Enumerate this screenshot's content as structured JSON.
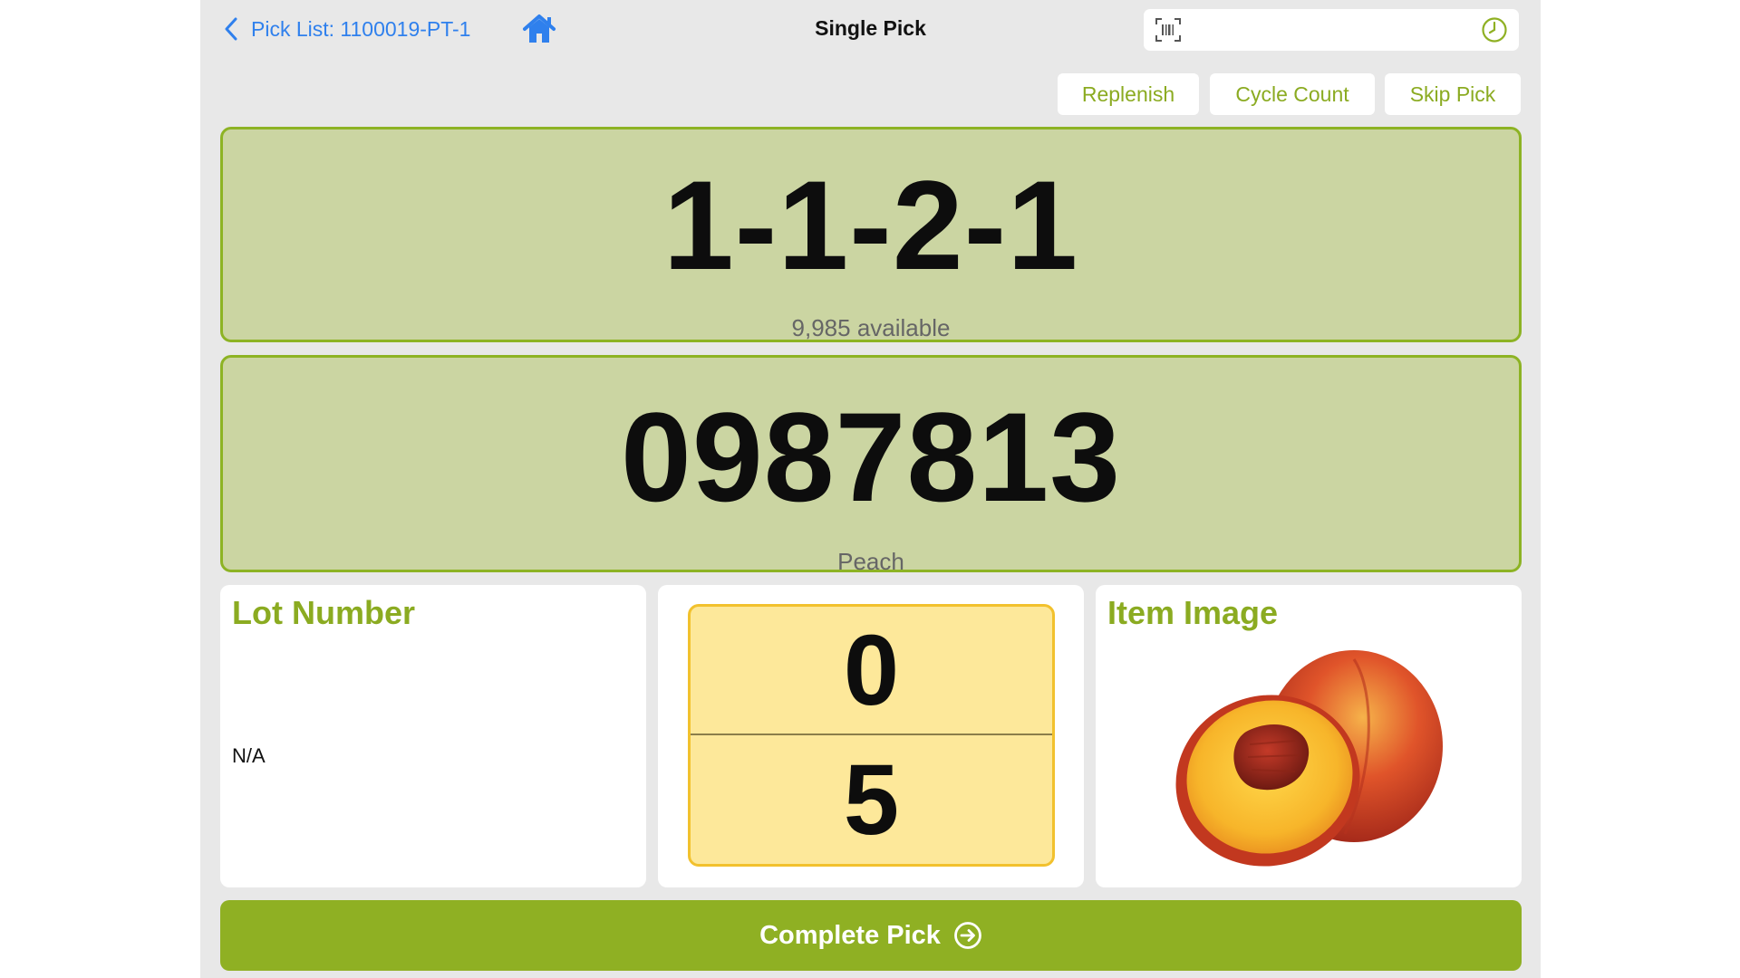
{
  "header": {
    "back_label": "Pick List: 1100019-PT-1",
    "title": "Single Pick",
    "search_placeholder": ""
  },
  "actions": {
    "replenish": "Replenish",
    "cycle_count": "Cycle Count",
    "skip_pick": "Skip Pick"
  },
  "location": {
    "code": "1-1-2-1",
    "available": "9,985 available"
  },
  "item": {
    "code": "0987813",
    "name": "Peach"
  },
  "lot": {
    "heading": "Lot Number",
    "value": "N/A"
  },
  "quantity": {
    "picked": "0",
    "required": "5"
  },
  "image_panel": {
    "heading": "Item Image",
    "image_icon": "peach-image"
  },
  "footer": {
    "complete_label": "Complete Pick"
  },
  "colors": {
    "accent_green": "#8fb023",
    "card_green": "#cbd5a2",
    "link_blue": "#2f80ed",
    "qty_yellow": "#fde89a"
  }
}
